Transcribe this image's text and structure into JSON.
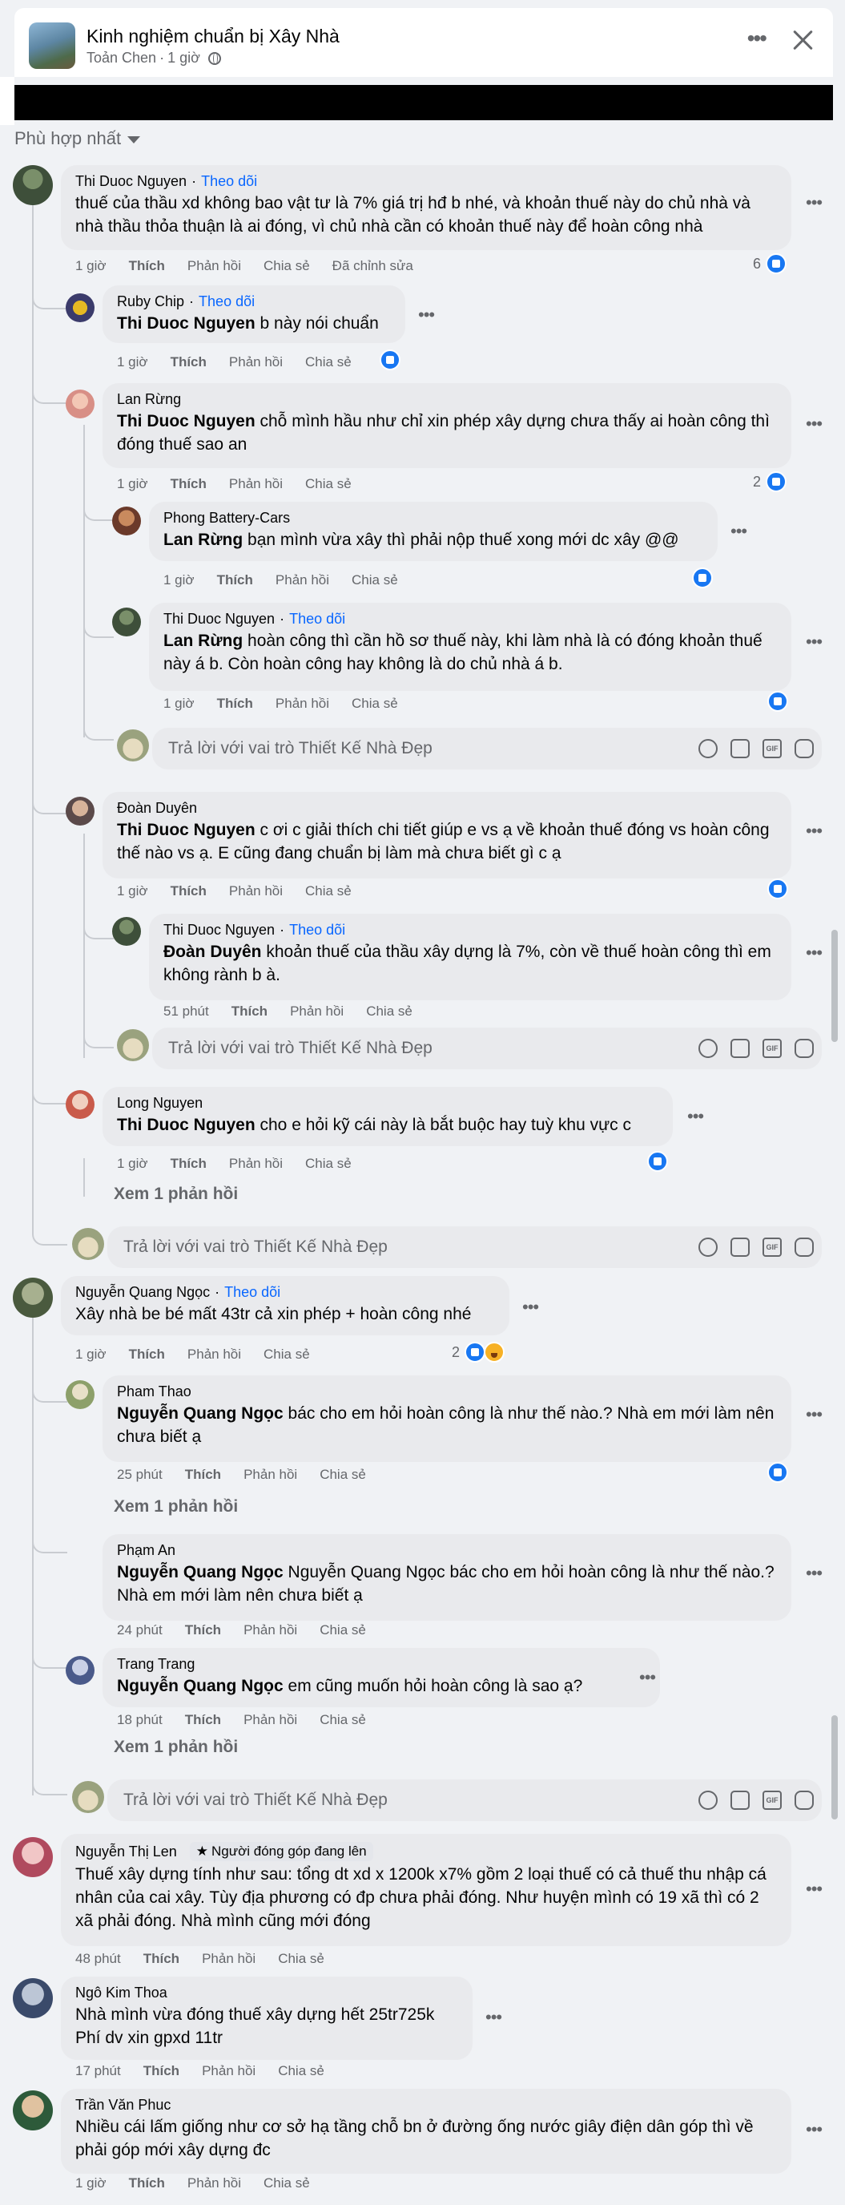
{
  "post": {
    "title": "Kinh nghiệm chuẩn bị Xây Nhà",
    "author": "Toản Chen",
    "time": "1 giờ",
    "sort_label": "Phù hợp nhất"
  },
  "reply_placeholder": "Trả lời với vai trò Thiết Kế Nhà Đẹp",
  "labels": {
    "like": "Thích",
    "reply": "Phản hồi",
    "share": "Chia sẻ",
    "edited": "Đã chỉnh sửa",
    "follow": "Theo dõi",
    "gif": "GIF"
  },
  "comments": [
    {
      "author": "Thi Duoc Nguyen",
      "follow": "Theo dõi",
      "text": "thuế của thầu xd không bao vật tư là 7% giá trị hđ b nhé, và khoản thuế này do chủ nhà và nhà thầu thỏa thuận là ai đóng, vì chủ nhà cần có khoản thuế này để hoàn công nhà",
      "time": "1 giờ",
      "reactions": "6"
    },
    {
      "author": "Ruby Chip",
      "follow": "Theo dõi",
      "mention": "Thi Duoc Nguyen",
      "text": " b này nói chuẩn",
      "time": "1 giờ"
    },
    {
      "author": "Lan Rừng",
      "mention": "Thi Duoc Nguyen",
      "text": " chỗ mình hầu như chỉ xin phép xây dựng chưa thấy ai hoàn công thì đóng thuế sao an",
      "time": "1 giờ",
      "reactions": "2"
    },
    {
      "author": "Phong Battery-Cars",
      "mention": "Lan Rừng",
      "text": " bạn mình vừa xây thì phải nộp thuế xong mới dc xây @@",
      "time": "1 giờ"
    },
    {
      "author": "Thi Duoc Nguyen",
      "follow": "Theo dõi",
      "mention": "Lan Rừng",
      "text": " hoàn công thì cần hồ sơ thuế này, khi làm nhà là có đóng khoản thuế này á b. Còn hoàn công hay không là do chủ nhà á b.",
      "time": "1 giờ"
    },
    {
      "author": "Đoàn Duyên",
      "mention": "Thi Duoc Nguyen",
      "text": " c ơi c giải thích chi tiết giúp e vs ạ về khoản thuế đóng vs hoàn công thế nào vs ạ. E cũng đang chuẩn bị làm mà chưa biết gì c ạ",
      "time": "1 giờ"
    },
    {
      "author": "Thi Duoc Nguyen",
      "follow": "Theo dõi",
      "mention": "Đoàn Duyên",
      "text": " khoản thuế của thầu xây dựng là 7%, còn về thuế hoàn công thì em không rành b à.",
      "time": "51 phút"
    },
    {
      "author": "Long Nguyen",
      "mention": "Thi Duoc Nguyen",
      "text": " cho e hỏi kỹ cái này là bắt buộc hay tuỳ khu vực c",
      "time": "1 giờ",
      "view_more": "Xem 1 phản hồi"
    },
    {
      "author": "Nguyễn Quang Ngọc",
      "follow": "Theo dõi",
      "text": "Xây nhà be bé mất 43tr cả xin phép + hoàn công nhé",
      "time": "1 giờ",
      "reactions": "2"
    },
    {
      "author": "Pham Thao",
      "mention": "Nguyễn Quang Ngọc",
      "text": " bác cho em hỏi hoàn công là như thế nào.? Nhà em mới làm nên chưa biết ạ",
      "time": "25 phút",
      "view_more": "Xem 1 phản hồi"
    },
    {
      "author": "Phạm An",
      "mention": "Nguyễn Quang Ngọc",
      "text": " Nguyễn Quang Ngọc bác cho em hỏi hoàn công là như thế nào.? Nhà em mới làm nên chưa biết ạ",
      "time": "24 phút"
    },
    {
      "author": "Trang Trang",
      "mention": "Nguyễn Quang Ngọc",
      "text": " em cũng muốn hỏi hoàn công là sao ạ?",
      "time": "18 phút",
      "view_more": "Xem 1 phản hồi"
    },
    {
      "author": "Nguyễn Thị Len",
      "badge": "Người đóng góp đang lên",
      "text": "Thuế xây dựng tính như sau: tổng dt xd x 1200k x7% gồm 2 loại thuế có cả thuế thu nhập cá nhân của cai xây. Tùy địa phương có đp chưa phải đóng. Như huyện mình có 19 xã thì có 2 xã phải đóng. Nhà mình cũng mới đóng",
      "time": "48 phút"
    },
    {
      "author": "Ngô Kim Thoa",
      "text": "Nhà mình vừa đóng thuế xây dựng hết 25tr725k\nPhí dv xin gpxd 11tr",
      "time": "17 phút"
    },
    {
      "author": "Trần Văn Phuc",
      "text": "Nhiều cái lấm giống như cơ sở hạ tầng chỗ bn ở đường ống nước giây điện dân góp thì về phải góp mới xây dựng đc",
      "time": "1 giờ"
    }
  ]
}
